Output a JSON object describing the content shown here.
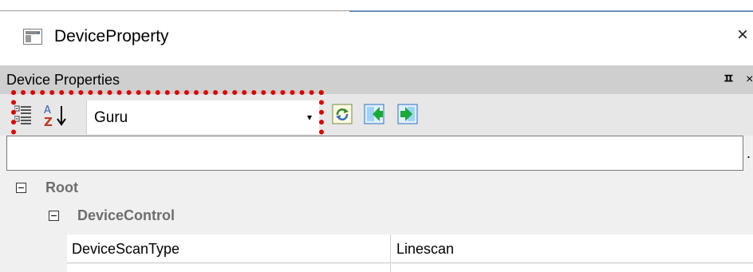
{
  "window": {
    "title": "DeviceProperty",
    "close_glyph": "×"
  },
  "panel": {
    "title": "Device Properties",
    "pin_glyph": "ㅍ",
    "close_glyph": "×"
  },
  "toolbar": {
    "categorized_icon": "categorized-view-icon",
    "alphabetical_icon": "alphabetical-sort-icon",
    "visibility_combo": {
      "selected": "Guru",
      "arrow": "▾"
    },
    "buttons": [
      "refresh-icon",
      "import-icon",
      "export-icon"
    ]
  },
  "search": {
    "value": "",
    "button": "."
  },
  "tree": {
    "root": {
      "label": "Root"
    },
    "category": {
      "label": "DeviceControl"
    },
    "properties": [
      {
        "name": "DeviceScanType",
        "value": "Linescan"
      }
    ]
  },
  "colors": {
    "highlight_box": "#e00000",
    "header_bg": "#cfcfcf",
    "category_text": "#6d6d6d"
  }
}
